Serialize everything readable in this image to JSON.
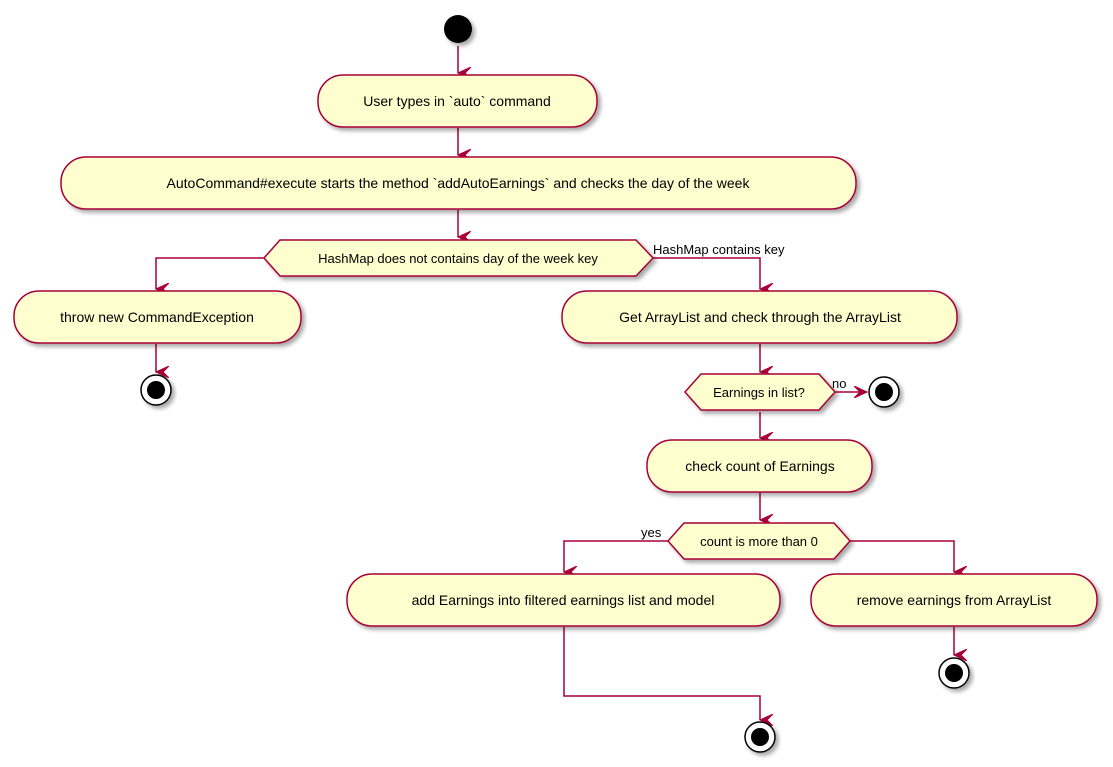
{
  "diagram": {
    "type": "activity",
    "colors": {
      "node_fill": "#FEFECE",
      "border": "#A80036",
      "start_end": "#000000",
      "shadow": "#c8c8c8"
    },
    "activities": {
      "user_types": "User types in `auto` command",
      "execute": "AutoCommand#execute starts the method `addAutoEarnings` and checks the day of the week",
      "throw": "throw new CommandException",
      "get_arraylist": "Get ArrayList and check through the ArrayList",
      "check_count": "check count of Earnings",
      "add_earnings": "add Earnings into filtered earnings list and model",
      "remove_earnings": "remove earnings from ArrayList"
    },
    "decisions": {
      "hashmap": "HashMap does not contains day of the week key",
      "earnings_in_list": "Earnings in list?",
      "count_more": "count is more than 0"
    },
    "edge_labels": {
      "hashmap_contains": "HashMap contains key",
      "no": "no",
      "yes": "yes"
    }
  }
}
